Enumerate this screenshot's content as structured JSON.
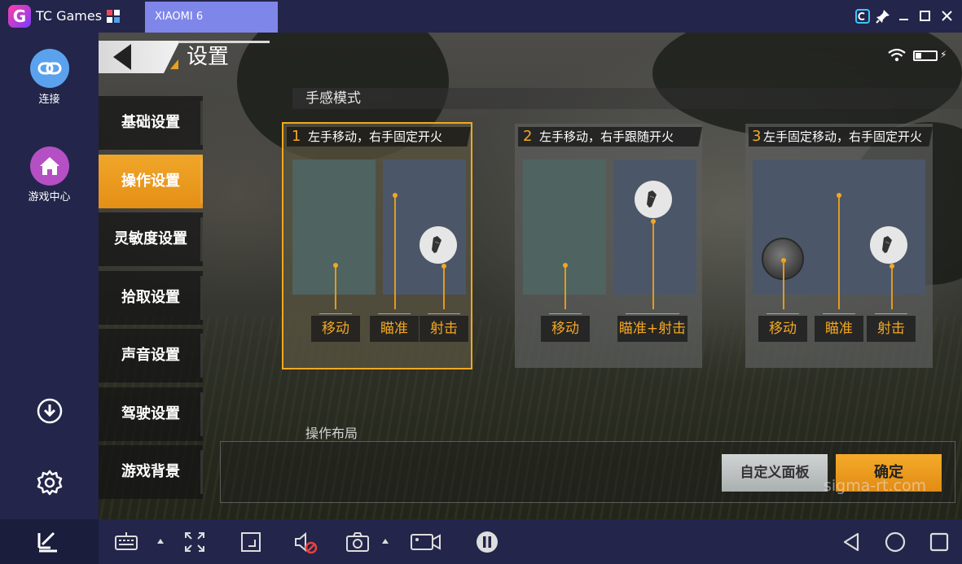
{
  "window": {
    "app_title": "TC Games",
    "tab_label": "XIAOMI 6"
  },
  "sidebar": {
    "items": [
      {
        "label": "连接",
        "icon": "link-icon",
        "color": "#5aa2ee"
      },
      {
        "label": "游戏中心",
        "icon": "home-icon",
        "color": "#b44fc4"
      }
    ]
  },
  "game": {
    "page_title": "设置",
    "menu": [
      {
        "label": "基础设置",
        "active": false
      },
      {
        "label": "操作设置",
        "active": true
      },
      {
        "label": "灵敏度设置",
        "active": false
      },
      {
        "label": "拾取设置",
        "active": false
      },
      {
        "label": "声音设置",
        "active": false
      },
      {
        "label": "驾驶设置",
        "active": false
      },
      {
        "label": "游戏背景",
        "active": false
      }
    ],
    "feel_mode_title": "手感模式",
    "modes": [
      {
        "num": "1",
        "title": "左手移动，右手固定开火",
        "labels": [
          "移动",
          "瞄准",
          "射击"
        ],
        "selected": true
      },
      {
        "num": "2",
        "title": "左手移动，右手跟随开火",
        "labels": [
          "移动",
          "瞄准+射击"
        ],
        "selected": false
      },
      {
        "num": "3",
        "title": "左手固定移动，右手固定开火",
        "labels": [
          "移动",
          "瞄准",
          "射击"
        ],
        "selected": false
      }
    ],
    "layout_title": "操作布局",
    "custom_panel_button": "自定义面板",
    "confirm_button": "确定",
    "watermark": "sigma-rt.com",
    "accent_color": "#f2a823"
  }
}
